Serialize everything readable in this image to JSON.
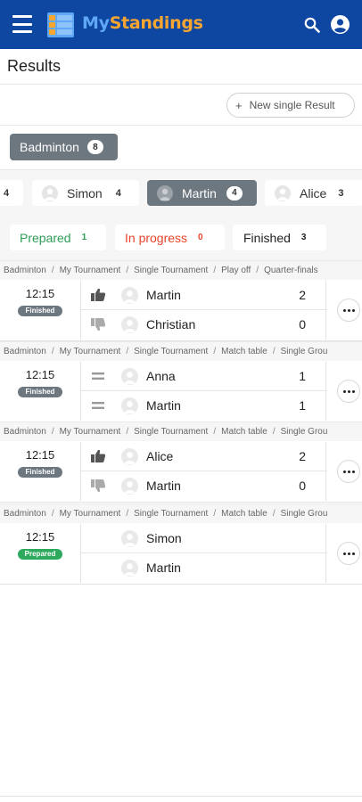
{
  "app": {
    "name_part1": "My",
    "name_part2": "Standings",
    "colors": {
      "bar": "#0d47a1",
      "brand_blue": "#5fa8f5",
      "brand_orange": "#f6a531"
    }
  },
  "page": {
    "title": "Results",
    "new_button_plus": "+",
    "new_button_label": "New  single Result"
  },
  "sport": {
    "label": "Badminton",
    "count": "8"
  },
  "players": [
    {
      "name": "",
      "count": "4",
      "active": false
    },
    {
      "name": "Simon",
      "count": "4",
      "active": false
    },
    {
      "name": "Martin",
      "count": "4",
      "active": true
    },
    {
      "name": "Alice",
      "count": "3",
      "active": false
    }
  ],
  "tabs": [
    {
      "label": "Prepared",
      "count": "1",
      "color": "#2e9e56"
    },
    {
      "label": "In progress",
      "count": "0",
      "color": "#e8442a"
    },
    {
      "label": "Finished",
      "count": "3",
      "color": "#222222"
    }
  ],
  "results": [
    {
      "crumb": [
        "Badminton",
        "My Tournament",
        "Single Tournament",
        "Play off",
        "Quarter-finals"
      ],
      "time": "12:15",
      "status": "Finished",
      "status_color": "#6d7780",
      "p1": {
        "name": "Martin",
        "score": "2",
        "icon": "thumbs-up-icon"
      },
      "p2": {
        "name": "Christian",
        "score": "0",
        "icon": "thumbs-down-icon"
      }
    },
    {
      "crumb": [
        "Badminton",
        "My Tournament",
        "Single Tournament",
        "Match table",
        "Single Grou"
      ],
      "time": "12:15",
      "status": "Finished",
      "status_color": "#6d7780",
      "p1": {
        "name": "Anna",
        "score": "1",
        "icon": "equals-icon"
      },
      "p2": {
        "name": "Martin",
        "score": "1",
        "icon": "equals-icon"
      }
    },
    {
      "crumb": [
        "Badminton",
        "My Tournament",
        "Single Tournament",
        "Match table",
        "Single Grou"
      ],
      "time": "12:15",
      "status": "Finished",
      "status_color": "#6d7780",
      "p1": {
        "name": "Alice",
        "score": "2",
        "icon": "thumbs-up-icon"
      },
      "p2": {
        "name": "Martin",
        "score": "0",
        "icon": "thumbs-down-icon"
      }
    },
    {
      "crumb": [
        "Badminton",
        "My Tournament",
        "Single Tournament",
        "Match table",
        "Single Grou"
      ],
      "time": "12:15",
      "status": "Prepared",
      "status_color": "#2eaa5e",
      "p1": {
        "name": "Simon",
        "score": "",
        "icon": ""
      },
      "p2": {
        "name": "Martin",
        "score": "",
        "icon": ""
      }
    }
  ]
}
